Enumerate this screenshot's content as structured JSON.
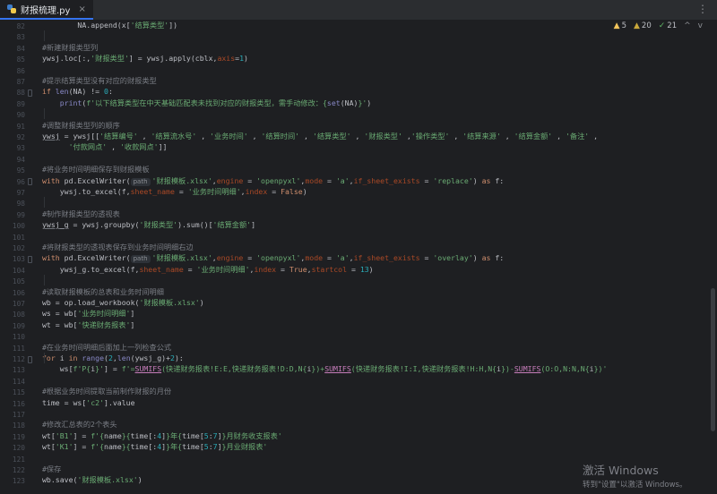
{
  "tab": {
    "filename": "财报梳理.py",
    "close": "×",
    "more": "⋮"
  },
  "inspections": {
    "warnings": "5",
    "weak_warnings": "20",
    "typos": "21",
    "nav_up": "^",
    "nav_down": "v"
  },
  "watermark": {
    "title": "激活 Windows",
    "subtitle": "转到\"设置\"以激活 Windows。"
  },
  "lines": [
    {
      "n": "82",
      "segs": [
        {
          "t": "        NA.append(x[",
          "c": "t-br"
        },
        {
          "t": "'结算类型'",
          "c": "t-str"
        },
        {
          "t": "])",
          "c": "t-br"
        }
      ]
    },
    {
      "n": "83",
      "segs": []
    },
    {
      "n": "84",
      "segs": [
        {
          "t": "#新建财报类型列",
          "c": "t-cm"
        }
      ]
    },
    {
      "n": "85",
      "segs": [
        {
          "t": "ywsj.loc[:,",
          "c": "t-br"
        },
        {
          "t": "'财报类型'",
          "c": "t-str"
        },
        {
          "t": "] = ywsj.apply(cblx,",
          "c": "t-br"
        },
        {
          "t": "axis",
          "c": "t-param"
        },
        {
          "t": "=",
          "c": "t-br"
        },
        {
          "t": "1",
          "c": "t-num"
        },
        {
          "t": ")",
          "c": "t-br"
        }
      ]
    },
    {
      "n": "86",
      "segs": []
    },
    {
      "n": "87",
      "segs": [
        {
          "t": "#提示结算类型没有对应的财报类型",
          "c": "t-cm"
        }
      ]
    },
    {
      "n": "88",
      "segs": [
        {
          "t": "if ",
          "c": "t-kw"
        },
        {
          "t": "len",
          "c": "t-builtin"
        },
        {
          "t": "(NA) != ",
          "c": "t-br"
        },
        {
          "t": "0",
          "c": "t-num"
        },
        {
          "t": ":",
          "c": "t-br"
        }
      ]
    },
    {
      "n": "89",
      "segs": [
        {
          "t": "    ",
          "c": "t-br"
        },
        {
          "t": "print",
          "c": "t-builtin"
        },
        {
          "t": "(",
          "c": "t-br"
        },
        {
          "t": "f'以下结算类型在中天基础匹配表未找到对应的财报类型，需手动修改：{",
          "c": "t-str"
        },
        {
          "t": "set",
          "c": "t-builtin"
        },
        {
          "t": "(NA)",
          "c": "t-br"
        },
        {
          "t": "}'",
          "c": "t-str"
        },
        {
          "t": ")",
          "c": "t-br"
        }
      ]
    },
    {
      "n": "90",
      "segs": []
    },
    {
      "n": "91",
      "segs": [
        {
          "t": "#调整财报类型列的顺序",
          "c": "t-cm"
        }
      ]
    },
    {
      "n": "92",
      "segs": [
        {
          "t": "ywsj",
          "c": "t-under"
        },
        {
          "t": " = ywsj[[",
          "c": "t-br"
        },
        {
          "t": "'结算编号'",
          "c": "t-str"
        },
        {
          "t": " , ",
          "c": "t-br"
        },
        {
          "t": "'结算流水号'",
          "c": "t-str"
        },
        {
          "t": " , ",
          "c": "t-br"
        },
        {
          "t": "'业务时间'",
          "c": "t-str"
        },
        {
          "t": " , ",
          "c": "t-br"
        },
        {
          "t": "'结算时间'",
          "c": "t-str"
        },
        {
          "t": " , ",
          "c": "t-br"
        },
        {
          "t": "'结算类型'",
          "c": "t-str"
        },
        {
          "t": " , ",
          "c": "t-br"
        },
        {
          "t": "'财报类型'",
          "c": "t-str"
        },
        {
          "t": " ,",
          "c": "t-br"
        },
        {
          "t": "'操作类型'",
          "c": "t-str"
        },
        {
          "t": " , ",
          "c": "t-br"
        },
        {
          "t": "'结算来源'",
          "c": "t-str"
        },
        {
          "t": " , ",
          "c": "t-br"
        },
        {
          "t": "'结算金额'",
          "c": "t-str"
        },
        {
          "t": " , ",
          "c": "t-br"
        },
        {
          "t": "'备注'",
          "c": "t-str"
        },
        {
          "t": " ,",
          "c": "t-br"
        }
      ]
    },
    {
      "n": "93",
      "segs": [
        {
          "t": "      ",
          "c": "t-br"
        },
        {
          "t": "'付款网点'",
          "c": "t-str"
        },
        {
          "t": " , ",
          "c": "t-br"
        },
        {
          "t": "'收款网点'",
          "c": "t-str"
        },
        {
          "t": "]]",
          "c": "t-br"
        }
      ]
    },
    {
      "n": "94",
      "segs": []
    },
    {
      "n": "95",
      "segs": [
        {
          "t": "#将业务时间明细保存到财报模板",
          "c": "t-cm"
        }
      ]
    },
    {
      "n": "96",
      "segs": [
        {
          "t": "with ",
          "c": "t-kw"
        },
        {
          "t": "pd.ExcelWriter(",
          "c": "t-br"
        },
        {
          "t": "path",
          "c": "t-hint"
        },
        {
          "t": "'财报模板.xlsx'",
          "c": "t-str"
        },
        {
          "t": ",",
          "c": "t-br"
        },
        {
          "t": "engine",
          "c": "t-param"
        },
        {
          "t": " = ",
          "c": "t-br"
        },
        {
          "t": "'openpyxl'",
          "c": "t-str"
        },
        {
          "t": ",",
          "c": "t-br"
        },
        {
          "t": "mode",
          "c": "t-param"
        },
        {
          "t": " = ",
          "c": "t-br"
        },
        {
          "t": "'a'",
          "c": "t-str"
        },
        {
          "t": ",",
          "c": "t-br"
        },
        {
          "t": "if_sheet_exists",
          "c": "t-param"
        },
        {
          "t": " = ",
          "c": "t-br"
        },
        {
          "t": "'replace'",
          "c": "t-str"
        },
        {
          "t": ") ",
          "c": "t-br"
        },
        {
          "t": "as ",
          "c": "t-kw"
        },
        {
          "t": "f:",
          "c": "t-br"
        }
      ]
    },
    {
      "n": "97",
      "segs": [
        {
          "t": "    ywsj.to_excel(f,",
          "c": "t-br"
        },
        {
          "t": "sheet_name",
          "c": "t-param"
        },
        {
          "t": " = ",
          "c": "t-br"
        },
        {
          "t": "'业务时间明细'",
          "c": "t-str"
        },
        {
          "t": ",",
          "c": "t-br"
        },
        {
          "t": "index",
          "c": "t-param"
        },
        {
          "t": " = ",
          "c": "t-br"
        },
        {
          "t": "False",
          "c": "t-kw"
        },
        {
          "t": ")",
          "c": "t-br"
        }
      ]
    },
    {
      "n": "98",
      "segs": []
    },
    {
      "n": "99",
      "segs": [
        {
          "t": "#制作财报类型的透视表",
          "c": "t-cm"
        }
      ]
    },
    {
      "n": "100",
      "segs": [
        {
          "t": "ywsj_g",
          "c": "t-under"
        },
        {
          "t": " = ywsj.groupby(",
          "c": "t-br"
        },
        {
          "t": "'财报类型'",
          "c": "t-str"
        },
        {
          "t": ").sum()[",
          "c": "t-br"
        },
        {
          "t": "'结算金额'",
          "c": "t-str"
        },
        {
          "t": "]",
          "c": "t-br"
        }
      ]
    },
    {
      "n": "101",
      "segs": []
    },
    {
      "n": "102",
      "segs": [
        {
          "t": "#将财报类型的透视表保存到业务时间明细右边",
          "c": "t-cm"
        }
      ]
    },
    {
      "n": "103",
      "segs": [
        {
          "t": "with ",
          "c": "t-kw"
        },
        {
          "t": "pd.ExcelWriter(",
          "c": "t-br"
        },
        {
          "t": "path",
          "c": "t-hint"
        },
        {
          "t": "'财报模板.xlsx'",
          "c": "t-str"
        },
        {
          "t": ",",
          "c": "t-br"
        },
        {
          "t": "engine",
          "c": "t-param"
        },
        {
          "t": " = ",
          "c": "t-br"
        },
        {
          "t": "'openpyxl'",
          "c": "t-str"
        },
        {
          "t": ",",
          "c": "t-br"
        },
        {
          "t": "mode",
          "c": "t-param"
        },
        {
          "t": " = ",
          "c": "t-br"
        },
        {
          "t": "'a'",
          "c": "t-str"
        },
        {
          "t": ",",
          "c": "t-br"
        },
        {
          "t": "if_sheet_exists",
          "c": "t-param"
        },
        {
          "t": " = ",
          "c": "t-br"
        },
        {
          "t": "'overlay'",
          "c": "t-str"
        },
        {
          "t": ") ",
          "c": "t-br"
        },
        {
          "t": "as ",
          "c": "t-kw"
        },
        {
          "t": "f:",
          "c": "t-br"
        }
      ]
    },
    {
      "n": "104",
      "segs": [
        {
          "t": "    ywsj_g.to_excel(f,",
          "c": "t-br"
        },
        {
          "t": "sheet_name",
          "c": "t-param"
        },
        {
          "t": " = ",
          "c": "t-br"
        },
        {
          "t": "'业务时间明细'",
          "c": "t-str"
        },
        {
          "t": ",",
          "c": "t-br"
        },
        {
          "t": "index",
          "c": "t-param"
        },
        {
          "t": " = ",
          "c": "t-br"
        },
        {
          "t": "True",
          "c": "t-kw"
        },
        {
          "t": ",",
          "c": "t-br"
        },
        {
          "t": "startcol",
          "c": "t-param"
        },
        {
          "t": " = ",
          "c": "t-br"
        },
        {
          "t": "13",
          "c": "t-num"
        },
        {
          "t": ")",
          "c": "t-br"
        }
      ]
    },
    {
      "n": "105",
      "segs": []
    },
    {
      "n": "106",
      "segs": [
        {
          "t": "#读取财报模板的总表和业务时间明细",
          "c": "t-cm"
        }
      ]
    },
    {
      "n": "107",
      "segs": [
        {
          "t": "wb = op.load_workbook(",
          "c": "t-br"
        },
        {
          "t": "'财报模板.xlsx'",
          "c": "t-str"
        },
        {
          "t": ")",
          "c": "t-br"
        }
      ]
    },
    {
      "n": "108",
      "segs": [
        {
          "t": "ws = wb[",
          "c": "t-br"
        },
        {
          "t": "'业务时间明细'",
          "c": "t-str"
        },
        {
          "t": "]",
          "c": "t-br"
        }
      ]
    },
    {
      "n": "109",
      "segs": [
        {
          "t": "wt = wb[",
          "c": "t-br"
        },
        {
          "t": "'快递财务报表'",
          "c": "t-str"
        },
        {
          "t": "]",
          "c": "t-br"
        }
      ]
    },
    {
      "n": "110",
      "segs": []
    },
    {
      "n": "111",
      "segs": [
        {
          "t": "#在业务时间明细后面加上一列检查公式",
          "c": "t-cm"
        }
      ]
    },
    {
      "n": "112",
      "segs": [
        {
          "t": "for ",
          "c": "t-kw"
        },
        {
          "t": "i ",
          "c": "t-br"
        },
        {
          "t": "in ",
          "c": "t-kw"
        },
        {
          "t": "range",
          "c": "t-builtin"
        },
        {
          "t": "(",
          "c": "t-br"
        },
        {
          "t": "2",
          "c": "t-num"
        },
        {
          "t": ",",
          "c": "t-br"
        },
        {
          "t": "len",
          "c": "t-builtin"
        },
        {
          "t": "(ywsj_g)+",
          "c": "t-br"
        },
        {
          "t": "2",
          "c": "t-num"
        },
        {
          "t": "):",
          "c": "t-br"
        }
      ]
    },
    {
      "n": "113",
      "segs": [
        {
          "t": "    ws[",
          "c": "t-br"
        },
        {
          "t": "f'P{",
          "c": "t-str"
        },
        {
          "t": "i",
          "c": "t-br"
        },
        {
          "t": "}'",
          "c": "t-str"
        },
        {
          "t": "] = ",
          "c": "t-br"
        },
        {
          "t": "f'=",
          "c": "t-str"
        },
        {
          "t": "SUMIFS",
          "c": "t-call"
        },
        {
          "t": "(快递财务报表!E:E,快递财务报表!D:D,N{",
          "c": "t-str"
        },
        {
          "t": "i",
          "c": "t-br"
        },
        {
          "t": "})+",
          "c": "t-str"
        },
        {
          "t": "SUMIFS",
          "c": "t-call"
        },
        {
          "t": "(快递财务报表!I:I,快递财务报表!H:H,N{",
          "c": "t-str"
        },
        {
          "t": "i",
          "c": "t-br"
        },
        {
          "t": "})-",
          "c": "t-str"
        },
        {
          "t": "SUMIFS",
          "c": "t-call"
        },
        {
          "t": "(O:O,N:N,N{",
          "c": "t-str"
        },
        {
          "t": "i",
          "c": "t-br"
        },
        {
          "t": "})'",
          "c": "t-str"
        }
      ]
    },
    {
      "n": "114",
      "segs": []
    },
    {
      "n": "115",
      "segs": [
        {
          "t": "#根据业务时间提取当前制作财报的月份",
          "c": "t-cm"
        }
      ]
    },
    {
      "n": "116",
      "segs": [
        {
          "t": "time = ws[",
          "c": "t-br"
        },
        {
          "t": "'c2'",
          "c": "t-str"
        },
        {
          "t": "].value",
          "c": "t-br"
        }
      ]
    },
    {
      "n": "117",
      "segs": []
    },
    {
      "n": "118",
      "segs": [
        {
          "t": "#修改汇总表的2个表头",
          "c": "t-cm"
        }
      ]
    },
    {
      "n": "119",
      "segs": [
        {
          "t": "wt[",
          "c": "t-br"
        },
        {
          "t": "'B1'",
          "c": "t-str"
        },
        {
          "t": "] = ",
          "c": "t-br"
        },
        {
          "t": "f'{",
          "c": "t-str"
        },
        {
          "t": "name",
          "c": "t-br"
        },
        {
          "t": "}{",
          "c": "t-str"
        },
        {
          "t": "time[:",
          "c": "t-br"
        },
        {
          "t": "4",
          "c": "t-num"
        },
        {
          "t": "]",
          "c": "t-br"
        },
        {
          "t": "}年{",
          "c": "t-str"
        },
        {
          "t": "time[",
          "c": "t-br"
        },
        {
          "t": "5",
          "c": "t-num"
        },
        {
          "t": ":",
          "c": "t-br"
        },
        {
          "t": "7",
          "c": "t-num"
        },
        {
          "t": "]",
          "c": "t-br"
        },
        {
          "t": "}月财务收支报表'",
          "c": "t-str"
        }
      ]
    },
    {
      "n": "120",
      "segs": [
        {
          "t": "wt[",
          "c": "t-br"
        },
        {
          "t": "'K1'",
          "c": "t-str"
        },
        {
          "t": "] = ",
          "c": "t-br"
        },
        {
          "t": "f'{",
          "c": "t-str"
        },
        {
          "t": "name",
          "c": "t-br"
        },
        {
          "t": "}{",
          "c": "t-str"
        },
        {
          "t": "time[:",
          "c": "t-br"
        },
        {
          "t": "4",
          "c": "t-num"
        },
        {
          "t": "]",
          "c": "t-br"
        },
        {
          "t": "}年{",
          "c": "t-str"
        },
        {
          "t": "time[",
          "c": "t-br"
        },
        {
          "t": "5",
          "c": "t-num"
        },
        {
          "t": ":",
          "c": "t-br"
        },
        {
          "t": "7",
          "c": "t-num"
        },
        {
          "t": "]",
          "c": "t-br"
        },
        {
          "t": "}月业财报表'",
          "c": "t-str"
        }
      ]
    },
    {
      "n": "121",
      "segs": []
    },
    {
      "n": "122",
      "segs": [
        {
          "t": "#保存",
          "c": "t-cm"
        }
      ]
    },
    {
      "n": "123",
      "segs": [
        {
          "t": "wb.save(",
          "c": "t-br"
        },
        {
          "t": "'财报模板.xlsx'",
          "c": "t-str"
        },
        {
          "t": ")",
          "c": "t-br"
        }
      ]
    }
  ]
}
